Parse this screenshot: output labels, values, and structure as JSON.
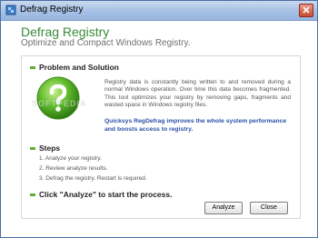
{
  "window": {
    "title": "Defrag Registry"
  },
  "header": {
    "title": "Defrag Registry",
    "subtitle": "Optimize and Compact Windows Registry."
  },
  "problem": {
    "heading": "Problem and Solution",
    "body": "Registry data is constantly being written to and removed during a normal Windows operation. Over time this data becomes fragmented. This tool optimizes your registry by removing gaps, fragments and wasted space in Windows registry files.",
    "highlight": "Quicksys RegDefrag improves the whole system performance and boosts access to registry."
  },
  "watermark": {
    "text": "SOFTPEDIA"
  },
  "steps": {
    "heading": "Steps",
    "items": [
      "1. Analyze your registry.",
      "2. Review analyze results.",
      "3. Defrag the registry. Restart is required."
    ]
  },
  "cta": {
    "text": "Click \"Analyze\" to start the process."
  },
  "buttons": {
    "analyze": "Analyze",
    "close": "Close"
  },
  "colors": {
    "accent_green": "#3a8b3a",
    "link_blue": "#2a4fa8",
    "bullet_green": "#5fae2f"
  }
}
